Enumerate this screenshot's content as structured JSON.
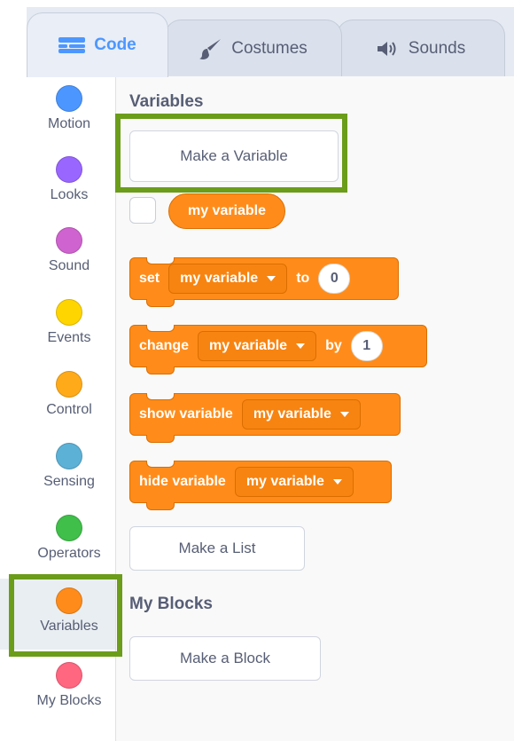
{
  "tabs": {
    "code": "Code",
    "costumes": "Costumes",
    "sounds": "Sounds"
  },
  "categories": [
    {
      "label": "Motion",
      "color": "#4c97ff"
    },
    {
      "label": "Looks",
      "color": "#9966ff"
    },
    {
      "label": "Sound",
      "color": "#cf63cf"
    },
    {
      "label": "Events",
      "color": "#ffd500"
    },
    {
      "label": "Control",
      "color": "#ffab19"
    },
    {
      "label": "Sensing",
      "color": "#5cb1d6"
    },
    {
      "label": "Operators",
      "color": "#40bf4a"
    },
    {
      "label": "Variables",
      "color": "#ff8c1a"
    },
    {
      "label": "My Blocks",
      "color": "#ff6680"
    }
  ],
  "palette": {
    "variables_title": "Variables",
    "make_variable": "Make a Variable",
    "variable_name": "my variable",
    "set_block": {
      "verb": "set",
      "var": "my variable",
      "to": "to",
      "value": "0"
    },
    "change_block": {
      "verb": "change",
      "var": "my variable",
      "by": "by",
      "value": "1"
    },
    "show_block": {
      "verb": "show variable",
      "var": "my variable"
    },
    "hide_block": {
      "verb": "hide variable",
      "var": "my variable"
    },
    "make_list": "Make a List",
    "myblocks_title": "My Blocks",
    "make_block": "Make a Block"
  }
}
